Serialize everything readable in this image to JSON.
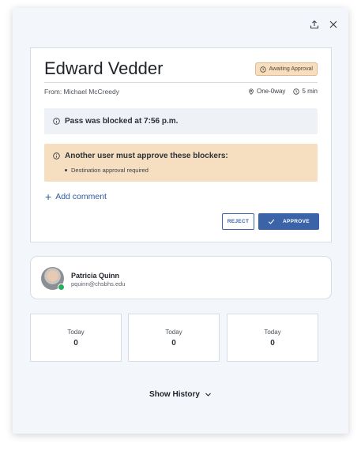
{
  "header": {
    "share_icon": "share-icon",
    "close_icon": "close-icon"
  },
  "pass": {
    "student_name": "Edward Vedder",
    "status": "Awaiting Approval",
    "status_colors": {
      "background": "#f6dec0",
      "border": "#e2b987"
    },
    "from": "From: Michael McCreedy",
    "route": "One-0way",
    "duration": "5 min",
    "blocked_message": "Pass was blocked at 7:56 p.m.",
    "approval_title": "Another user must approve these blockers:",
    "blockers": [
      "Destination approval required"
    ],
    "add_comment_label": "Add comment",
    "reject_label": "REJECT",
    "approve_label": "APPROVE",
    "accent_color": "#3b64a8"
  },
  "profile": {
    "name": "Patricia Quinn",
    "email": "pquinn@chsbhs.edu",
    "status": "online"
  },
  "stats": [
    {
      "label": "Today",
      "value": "0"
    },
    {
      "label": "Today",
      "value": "0"
    },
    {
      "label": "Today",
      "value": "0"
    }
  ],
  "footer": {
    "show_history_label": "Show History"
  }
}
